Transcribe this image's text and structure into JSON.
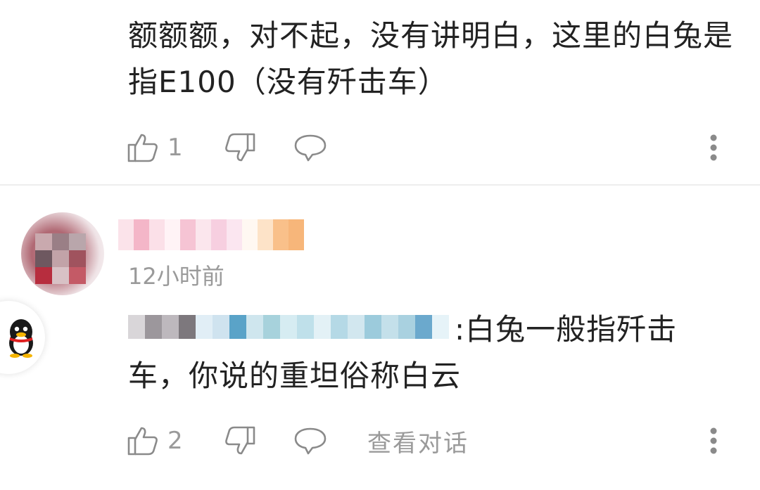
{
  "comments": [
    {
      "text": "额额额，对不起，没有讲明白，这里的白兔是指E100（没有歼击车）",
      "likes": "1"
    },
    {
      "time": "12小时前",
      "text_prefix": ":白兔一般指歼击",
      "text": "车，你说的重坦俗称白云",
      "likes": "2",
      "view_conversation": "查看对话"
    }
  ],
  "icons": {
    "like": "thumbs-up-icon",
    "dislike": "thumbs-down-icon",
    "reply": "speech-bubble-icon",
    "more": "more-vertical-icon",
    "floating": "qq-penguin-icon"
  },
  "colors": {
    "text": "#222222",
    "secondary": "#9a9a9a",
    "divider": "#eeeeee"
  }
}
